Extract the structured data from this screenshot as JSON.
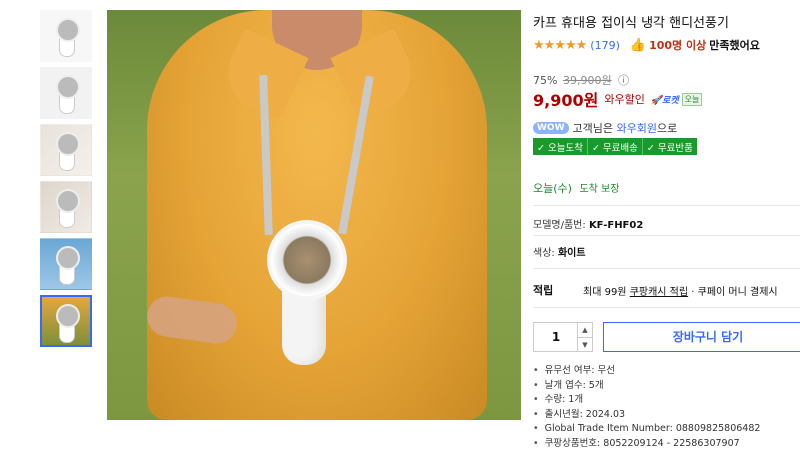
{
  "product": {
    "title": "카프 휴대용 접이식 냉각 핸디선풍기",
    "stars": "★★★★★",
    "review_count": "(179)",
    "satisfied_count": "100명 이상",
    "satisfied_text": "만족했어요"
  },
  "pricing": {
    "discount_percent": "75%",
    "original_price": "39,900원",
    "price": "9,900원",
    "wow_discount": "와우할인",
    "rocket_label": "🚀로켓",
    "today_badge": "오늘"
  },
  "wow": {
    "badge": "WOW",
    "text_prefix": "고객님은",
    "member_link": "와우회원",
    "text_suffix": "으로",
    "benefits": [
      "✓ 오늘도착",
      "✓ 무료배송",
      "✓ 무료반품"
    ]
  },
  "delivery": {
    "date": "오늘(수)",
    "guarantee": "도착 보장"
  },
  "model": {
    "label": "모델명/품번:",
    "value": "KF-FHF02"
  },
  "color": {
    "label": "색상:",
    "value": "화이트"
  },
  "points": {
    "label": "적립",
    "max": "최대 99원",
    "link": "쿠팡캐시 적립",
    "rest": "· 쿠페이 머니 결제시"
  },
  "purchase": {
    "quantity": "1",
    "cart_label": "장바구니 담기"
  },
  "specs": [
    "유무선 여부: 무선",
    "날개 엽수: 5개",
    "수량: 1개",
    "출시년월: 2024.03",
    "Global Trade Item Number: 08809825806482",
    "쿠팡상품번호: 8052209124 - 22586307907"
  ],
  "colors": {
    "price_red": "#ae0000",
    "link_blue": "#346aff",
    "benefit_green": "#1a9a2a",
    "star_orange": "#f09a2c"
  },
  "icons": {
    "thumbs_up": "thumbs-up-icon",
    "info": "info-icon",
    "rocket": "rocket-icon"
  }
}
